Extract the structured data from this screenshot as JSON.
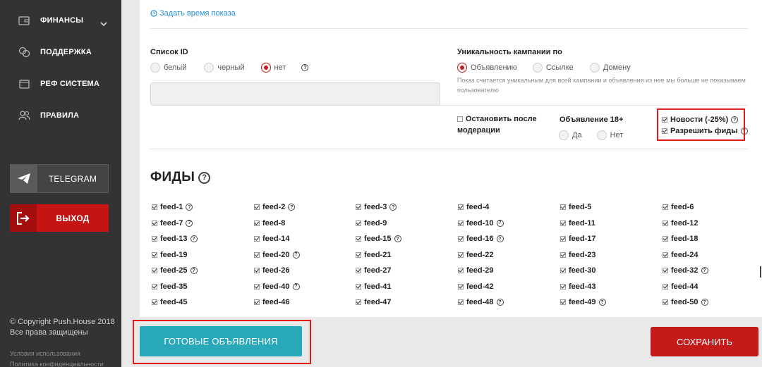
{
  "sidebar": {
    "items": [
      {
        "label": "ФИНАНСЫ",
        "icon": "wallet-icon"
      },
      {
        "label": "ПОДДЕРЖКА",
        "icon": "chat-icon"
      },
      {
        "label": "РЕФ СИСТЕМА",
        "icon": "calendar-icon"
      },
      {
        "label": "ПРАВИЛА",
        "icon": "users-icon"
      }
    ],
    "telegram_label": "TELEGRAM",
    "exit_label": "ВЫХОД",
    "copyright_line1": "© Copyright Push.House 2018",
    "copyright_line2": "Все права защищены",
    "footer_link1": "Условия использования",
    "footer_link2": "Политика конфиденциальности"
  },
  "form": {
    "set_time_link": "Задать время показа",
    "list_id": {
      "label": "Список ID",
      "options": [
        "белый",
        "черный",
        "нет"
      ],
      "selected": "нет"
    },
    "uniqueness": {
      "label": "Уникальность кампании по",
      "options": [
        "Объявлению",
        "Ссылке",
        "Домену"
      ],
      "selected": "Объявлению",
      "note": "Показ считается уникальным для всей кампании и объявления из нее мы больше не показываем пользователю"
    },
    "stop_after_moderation": {
      "line1": "Остановить после",
      "line2": "модерации",
      "checked": false
    },
    "ad18": {
      "label": "Объявление 18+",
      "options": [
        "Да",
        "Нет"
      ]
    },
    "news": {
      "label": "Новости (-25%)",
      "checked": true
    },
    "allow_feeds": {
      "label": "Разрешить фиды",
      "checked": true
    }
  },
  "feeds": {
    "title": "ФИДЫ",
    "items": [
      {
        "name": "feed-1",
        "help": true
      },
      {
        "name": "feed-2",
        "help": true
      },
      {
        "name": "feed-3",
        "help": true
      },
      {
        "name": "feed-4",
        "help": false
      },
      {
        "name": "feed-5",
        "help": false
      },
      {
        "name": "feed-6",
        "help": false
      },
      {
        "name": "feed-7",
        "help": true
      },
      {
        "name": "feed-8",
        "help": false
      },
      {
        "name": "feed-9",
        "help": false
      },
      {
        "name": "feed-10",
        "help": true
      },
      {
        "name": "feed-11",
        "help": false
      },
      {
        "name": "feed-12",
        "help": false
      },
      {
        "name": "feed-13",
        "help": true
      },
      {
        "name": "feed-14",
        "help": false
      },
      {
        "name": "feed-15",
        "help": true
      },
      {
        "name": "feed-16",
        "help": true
      },
      {
        "name": "feed-17",
        "help": false
      },
      {
        "name": "feed-18",
        "help": false
      },
      {
        "name": "feed-19",
        "help": false
      },
      {
        "name": "feed-20",
        "help": true
      },
      {
        "name": "feed-21",
        "help": false
      },
      {
        "name": "feed-22",
        "help": false
      },
      {
        "name": "feed-23",
        "help": false
      },
      {
        "name": "feed-24",
        "help": false
      },
      {
        "name": "feed-25",
        "help": true
      },
      {
        "name": "feed-26",
        "help": false
      },
      {
        "name": "feed-27",
        "help": false
      },
      {
        "name": "feed-29",
        "help": false
      },
      {
        "name": "feed-30",
        "help": false
      },
      {
        "name": "feed-32",
        "help": true
      },
      {
        "name": "feed-35",
        "help": false
      },
      {
        "name": "feed-40",
        "help": true
      },
      {
        "name": "feed-41",
        "help": false
      },
      {
        "name": "feed-42",
        "help": false
      },
      {
        "name": "feed-43",
        "help": false
      },
      {
        "name": "feed-44",
        "help": false
      },
      {
        "name": "feed-45",
        "help": false
      },
      {
        "name": "feed-46",
        "help": false
      },
      {
        "name": "feed-47",
        "help": false
      },
      {
        "name": "feed-48",
        "help": true
      },
      {
        "name": "feed-49",
        "help": true
      },
      {
        "name": "feed-50",
        "help": true
      }
    ]
  },
  "actions": {
    "ready_ads_label": "ГОТОВЫЕ ОБЪЯВЛЕНИЯ",
    "save_label": "СОХРАНИТЬ"
  },
  "colors": {
    "accent_red": "#c51a1a",
    "teal": "#29a8b9",
    "sidebar_bg": "#333333",
    "link_blue": "#2a8fd3"
  }
}
